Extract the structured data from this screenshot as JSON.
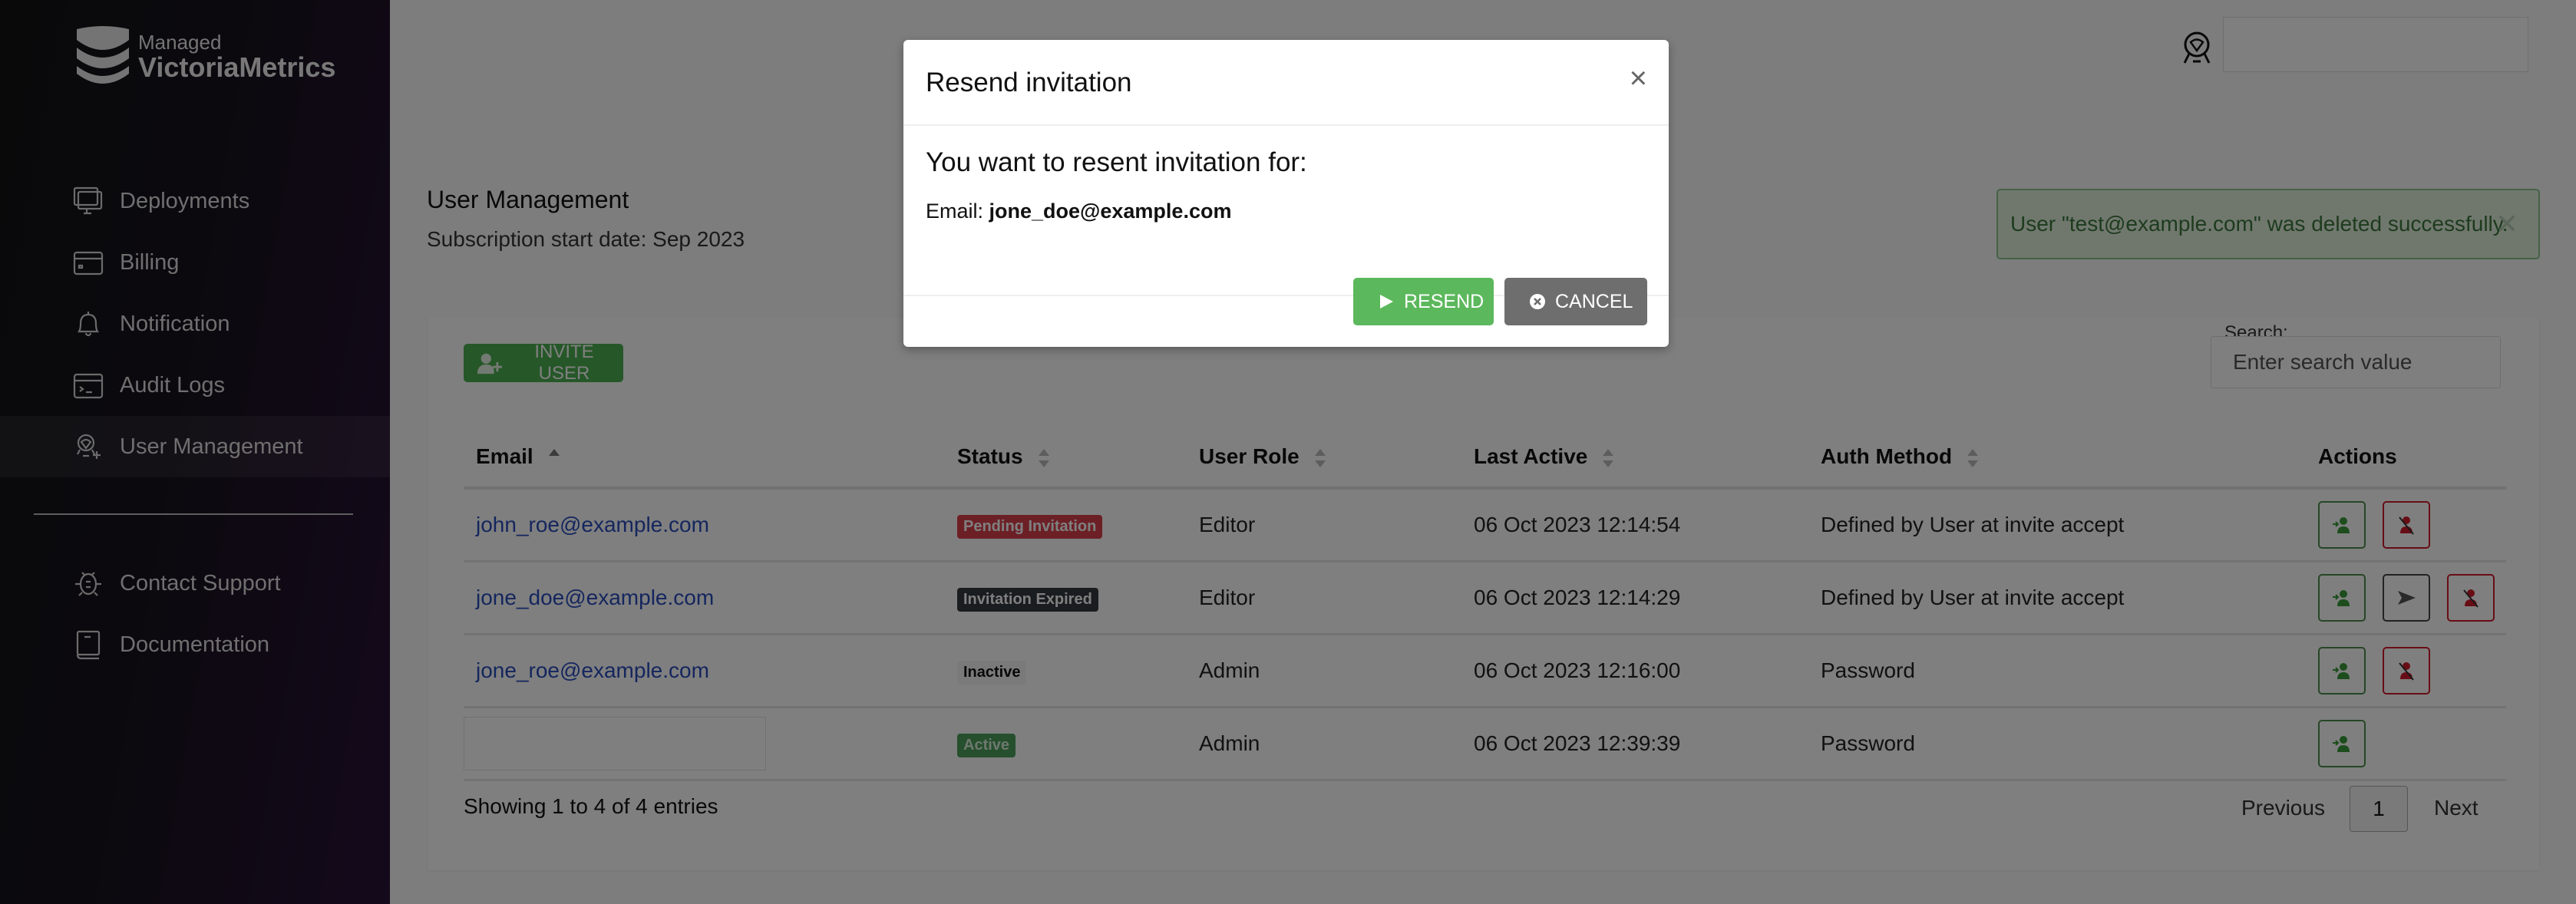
{
  "app": {
    "logo_line1": "Managed",
    "logo_line2": "VictoriaMetrics"
  },
  "sidebar": {
    "items": [
      {
        "label": "Deployments",
        "icon": "monitor-icon"
      },
      {
        "label": "Billing",
        "icon": "credit-card-icon"
      },
      {
        "label": "Notification",
        "icon": "bell-icon"
      },
      {
        "label": "Audit Logs",
        "icon": "terminal-icon"
      },
      {
        "label": "User Management",
        "icon": "user-add-icon",
        "active": true
      }
    ],
    "bottom_items": [
      {
        "label": "Contact Support",
        "icon": "bug-icon"
      },
      {
        "label": "Documentation",
        "icon": "book-icon"
      }
    ]
  },
  "header": {
    "title": "User Management",
    "subtitle": "Subscription start date: Sep 2023"
  },
  "alert": {
    "message": "User \"test@example.com\" was deleted successfully.",
    "close_label": "✕",
    "color": "#3c763d"
  },
  "toolbar": {
    "invite_label": "INVITE USER",
    "search_label": "Search:",
    "search_placeholder": "Enter search value",
    "search_value": ""
  },
  "table": {
    "columns": [
      "Email",
      "Status",
      "User Role",
      "Last Active",
      "Auth Method",
      "Actions"
    ],
    "sort": {
      "column": "Email",
      "direction": "asc"
    },
    "rows": [
      {
        "email": "john_roe@example.com",
        "status": "Pending Invitation",
        "status_type": "pending",
        "role": "Editor",
        "last_active": "06 Oct 2023 12:14:54",
        "auth": "Defined by User at invite accept",
        "actions": [
          "edit",
          "delete"
        ]
      },
      {
        "email": "jone_doe@example.com",
        "status": "Invitation Expired",
        "status_type": "expired",
        "role": "Editor",
        "last_active": "06 Oct 2023 12:14:29",
        "auth": "Defined by User at invite accept",
        "actions": [
          "edit",
          "resend",
          "delete"
        ]
      },
      {
        "email": "jone_roe@example.com",
        "status": "Inactive",
        "status_type": "inactive",
        "role": "Admin",
        "last_active": "06 Oct 2023 12:16:00",
        "auth": "Password",
        "actions": [
          "edit",
          "delete"
        ]
      },
      {
        "email": "",
        "email_redacted": true,
        "status": "Active",
        "status_type": "active",
        "role": "Admin",
        "last_active": "06 Oct 2023 12:39:39",
        "auth": "Password",
        "actions": [
          "edit"
        ]
      }
    ]
  },
  "footer": {
    "info": "Showing 1 to 4 of 4 entries",
    "prev": "Previous",
    "current_page": "1",
    "next": "Next"
  },
  "modal": {
    "title": "Resend invitation",
    "close": "×",
    "question": "You want to resent invitation for:",
    "email_label": "Email:",
    "email_value": "jone_doe@example.com",
    "resend_label": "RESEND",
    "cancel_label": "CANCEL"
  },
  "colors": {
    "success": "#5cb85c",
    "danger": "#d11a2a",
    "link": "#2a4dbd"
  }
}
